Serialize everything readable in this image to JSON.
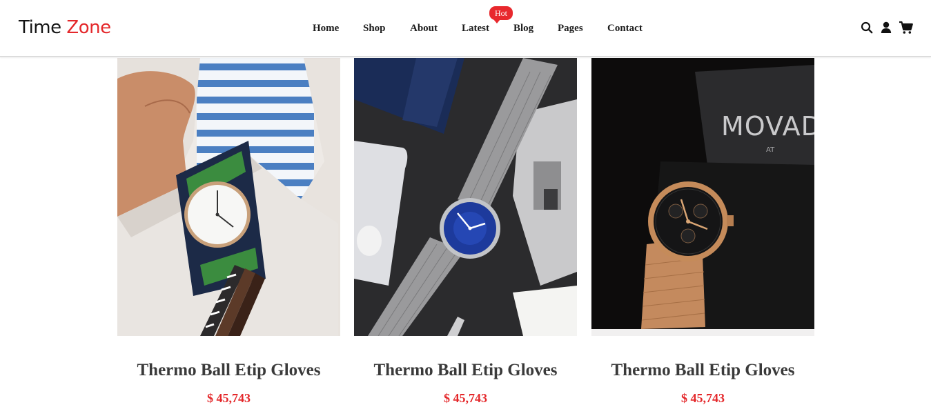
{
  "brand": {
    "logo_part1": "Time",
    "logo_part2": "Zone",
    "accent_color": "#e4282b"
  },
  "nav": {
    "items": [
      {
        "label": "Home"
      },
      {
        "label": "Shop"
      },
      {
        "label": "About"
      },
      {
        "label": "Latest"
      },
      {
        "label": "Blog"
      },
      {
        "label": "Pages"
      },
      {
        "label": "Contact"
      }
    ],
    "hot_badge": "Hot"
  },
  "header_icons": [
    "search-icon",
    "user-icon",
    "cart-icon"
  ],
  "products": [
    {
      "title": "Thermo Ball Etip Gloves",
      "price": "$ 45,743",
      "image": "watch-on-wrist-photo"
    },
    {
      "title": "Thermo Ball Etip Gloves",
      "price": "$ 45,743",
      "image": "blue-dial-mesh-watch-photo"
    },
    {
      "title": "Thermo Ball Etip Gloves",
      "price": "$ 45,743",
      "image": "gold-chronograph-watch-photo",
      "image_brand_text": "MOVADO",
      "image_brand_sub": "AT"
    }
  ]
}
